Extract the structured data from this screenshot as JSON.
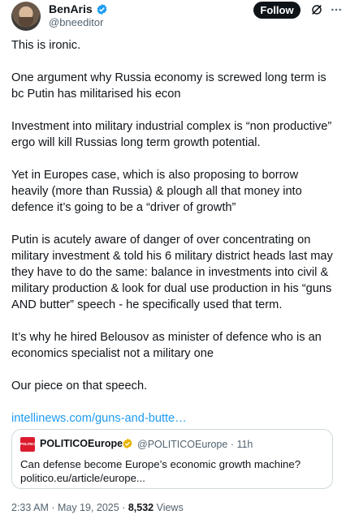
{
  "author": {
    "name": "BenAris",
    "handle": "@bneeditor",
    "follow_label": "Follow"
  },
  "icons": {
    "verified": "verified-badge-icon",
    "grok": "grok-icon",
    "more": "more-icon"
  },
  "colors": {
    "verified": "#1d9bf0",
    "link": "#1d9bf0",
    "follow_bg": "#0f1419",
    "gold_badge": "#e8b400",
    "politico": "#dc1c2e"
  },
  "tweet": {
    "paragraphs": [
      "This is ironic.",
      "One argument why Russia economy is screwed long term is bc Putin has militarised his econ",
      "Investment into military industrial complex is “non productive” ergo will kill Russias long term growth potential.",
      "Yet in Europes case, which is also proposing to borrow heavily (more than Russia) & plough all that money into defence it’s going to be a “driver of growth”",
      "Putin is acutely aware of danger of over concentrating on military investment & told his 6 military district heads last may they have to do the same: balance in investments into civil & military production & look for dual use production in his “guns AND butter” speech - he specifically used that term.",
      "It’s why he hired Belousov as minister of defence who is an economics specialist not a military one",
      "Our piece on that speech."
    ],
    "link": "intellinews.com/guns-and-butte…"
  },
  "quote": {
    "logo_text": "POLITICO",
    "name": "POLITICOEurope",
    "handle_time": "@POLITICOEurope · 11h",
    "text": "Can defense become Europe’s economic growth machine? politico.eu/article/europe..."
  },
  "meta": {
    "timestamp": "2:33 AM · May 19, 2025 · ",
    "views_count": "8,532",
    "views_label": " Views"
  }
}
